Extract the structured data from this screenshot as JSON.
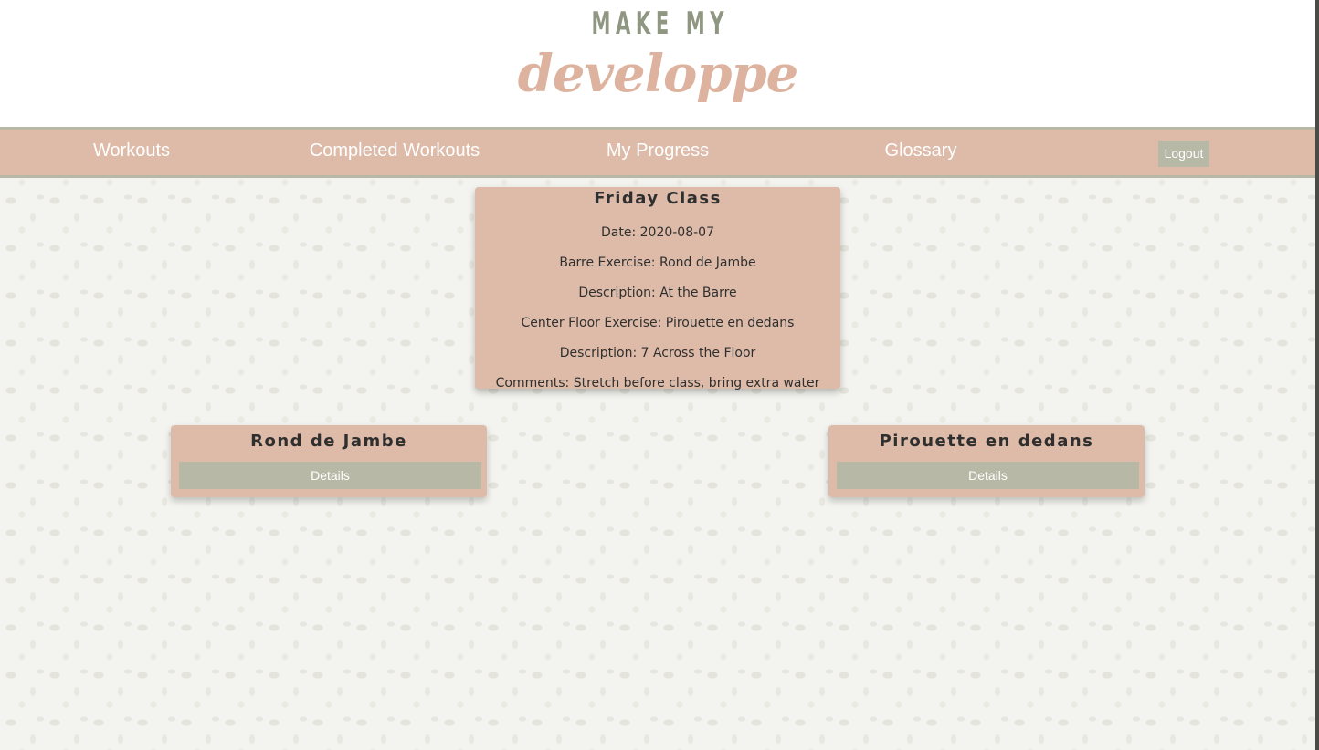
{
  "logo": {
    "top_text": "MAKE MY",
    "script_text": "developpe"
  },
  "nav": {
    "items": [
      {
        "label": "Workouts"
      },
      {
        "label": "Completed Workouts"
      },
      {
        "label": "My Progress"
      },
      {
        "label": "Glossary"
      }
    ],
    "logout_label": "Logout"
  },
  "workout": {
    "title": "Friday Class",
    "date": "Date: 2020-08-07",
    "barre_exercise": "Barre Exercise: Rond de Jambe",
    "barre_description": "Description: At the Barre",
    "center_exercise": "Center Floor Exercise: Pirouette en dedans",
    "center_description": "Description: 7 Across the Floor",
    "comments": "Comments: Stretch before class, bring extra water"
  },
  "exercises": [
    {
      "name": "Rond de Jambe",
      "button_label": "Details"
    },
    {
      "name": "Pirouette en dedans",
      "button_label": "Details"
    }
  ],
  "colors": {
    "accent_rose": "#ddbba8",
    "accent_sage": "#b7b9a6",
    "logo_green": "#8f9682",
    "logo_rose": "#ddb3a0"
  }
}
